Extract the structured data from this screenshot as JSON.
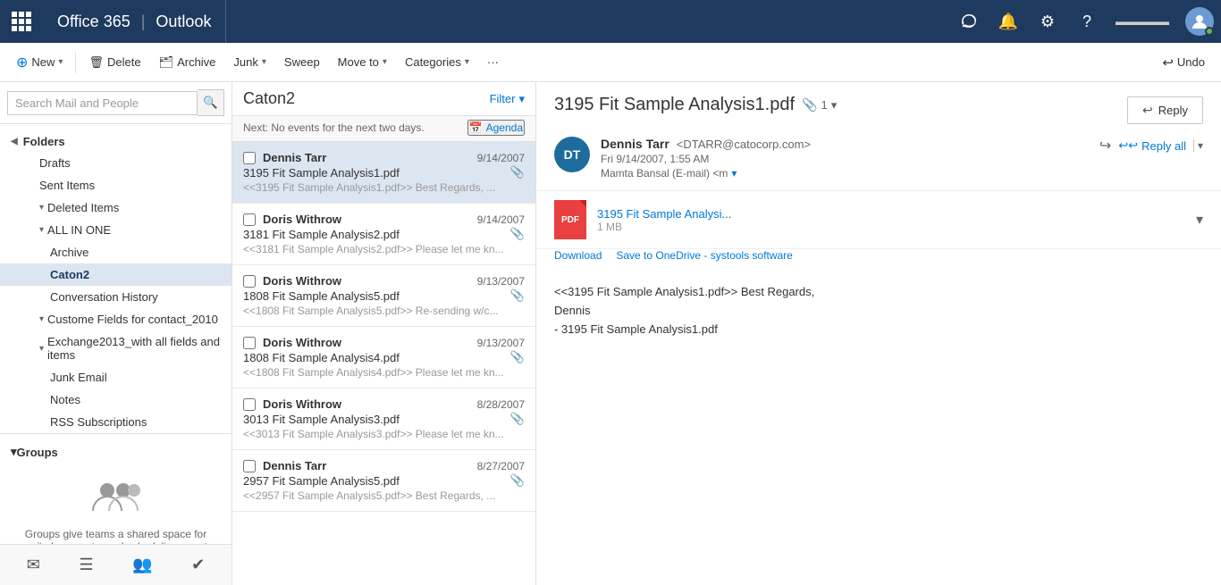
{
  "topbar": {
    "brand": "Office 365",
    "sep": "|",
    "app": "Outlook",
    "icons": {
      "skype": "S",
      "bell": "🔔",
      "settings": "⚙",
      "help": "?"
    },
    "avatar_initials": "👤"
  },
  "toolbar": {
    "new_label": "New",
    "delete_label": "Delete",
    "archive_label": "Archive",
    "junk_label": "Junk",
    "sweep_label": "Sweep",
    "moveto_label": "Move to",
    "categories_label": "Categories",
    "more_label": "···",
    "undo_label": "Undo"
  },
  "search": {
    "placeholder": "Search Mail and People"
  },
  "sidebar": {
    "folders_label": "Folders",
    "drafts": "Drafts",
    "sent_items": "Sent Items",
    "deleted_items": "Deleted Items",
    "all_in_one": "ALL IN ONE",
    "archive": "Archive",
    "caton2": "Caton2",
    "conversation_history": "Conversation History",
    "custom_fields": "Custome Fields for contact_2010",
    "exchange2013": "Exchange2013_with all fields and items",
    "junk_email": "Junk Email",
    "notes": "Notes",
    "rss": "RSS Subscriptions",
    "groups_label": "Groups",
    "groups_desc": "Groups give teams a shared space for email, documents, and scheduling events."
  },
  "email_list": {
    "title": "Caton2",
    "filter_label": "Filter",
    "next_label": "Next: No events for the next two days.",
    "agenda_label": "Agenda",
    "emails": [
      {
        "sender": "Dennis Tarr",
        "subject": "3195 Fit Sample Analysis1.pdf",
        "preview": "<<3195 Fit Sample Analysis1.pdf>> Best Regards,  ...",
        "date": "9/14/2007",
        "has_attachment": true,
        "selected": true
      },
      {
        "sender": "Doris Withrow",
        "subject": "3181 Fit Sample Analysis2.pdf",
        "preview": "<<3181 Fit Sample Analysis2.pdf>> Please let me kn...",
        "date": "9/14/2007",
        "has_attachment": true,
        "selected": false
      },
      {
        "sender": "Doris Withrow",
        "subject": "1808 Fit Sample Analysis5.pdf",
        "preview": "<<1808 Fit Sample Analysis5.pdf>> Re-sending w/c...",
        "date": "9/13/2007",
        "has_attachment": true,
        "selected": false
      },
      {
        "sender": "Doris Withrow",
        "subject": "1808 Fit Sample Analysis4.pdf",
        "preview": "<<1808 Fit Sample Analysis4.pdf>> Please let me kn...",
        "date": "9/13/2007",
        "has_attachment": true,
        "selected": false
      },
      {
        "sender": "Doris Withrow",
        "subject": "3013 Fit Sample Analysis3.pdf",
        "preview": "<<3013 Fit Sample Analysis3.pdf>> Please let me kn...",
        "date": "8/28/2007",
        "has_attachment": true,
        "selected": false
      },
      {
        "sender": "Dennis Tarr",
        "subject": "2957 Fit Sample Analysis5.pdf",
        "preview": "<<2957 Fit Sample Analysis5.pdf>> Best Regards,  ...",
        "date": "8/27/2007",
        "has_attachment": true,
        "selected": false
      }
    ]
  },
  "email_detail": {
    "title": "3195 Fit Sample Analysis1.pdf",
    "attachment_count": "1",
    "reply_label": "Reply",
    "reply_all_label": "Reply all",
    "sender_initials": "DT",
    "sender_name": "Dennis Tarr",
    "sender_email": "DTARR@catocorp.com",
    "sent_date": "Fri 9/14/2007, 1:55 AM",
    "to_label": "Mamta Bansal (E-mail) <m",
    "attachment_name": "3195 Fit Sample Analysi...",
    "attachment_full_name": "3195 Fit Sample Analysis1.pdf",
    "attachment_size": "1 MB",
    "download_label": "Download",
    "save_to_onedrive_label": "Save to OneDrive - systools software",
    "body_line1": "<<3195 Fit Sample Analysis1.pdf>> Best Regards,",
    "body_line2": "Dennis",
    "body_line3": "- 3195 Fit Sample Analysis1.pdf"
  },
  "footer": {
    "mail_icon": "✉",
    "calendar_icon": "📅",
    "people_icon": "👥",
    "tasks_icon": "✔"
  }
}
